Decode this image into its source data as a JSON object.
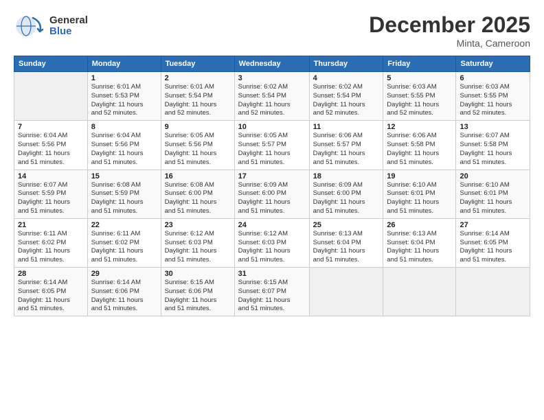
{
  "logo": {
    "general": "General",
    "blue": "Blue"
  },
  "header": {
    "title": "December 2025",
    "location": "Minta, Cameroon"
  },
  "days_of_week": [
    "Sunday",
    "Monday",
    "Tuesday",
    "Wednesday",
    "Thursday",
    "Friday",
    "Saturday"
  ],
  "weeks": [
    [
      {
        "day": "",
        "info": ""
      },
      {
        "day": "1",
        "info": "Sunrise: 6:01 AM\nSunset: 5:53 PM\nDaylight: 11 hours\nand 52 minutes."
      },
      {
        "day": "2",
        "info": "Sunrise: 6:01 AM\nSunset: 5:54 PM\nDaylight: 11 hours\nand 52 minutes."
      },
      {
        "day": "3",
        "info": "Sunrise: 6:02 AM\nSunset: 5:54 PM\nDaylight: 11 hours\nand 52 minutes."
      },
      {
        "day": "4",
        "info": "Sunrise: 6:02 AM\nSunset: 5:54 PM\nDaylight: 11 hours\nand 52 minutes."
      },
      {
        "day": "5",
        "info": "Sunrise: 6:03 AM\nSunset: 5:55 PM\nDaylight: 11 hours\nand 52 minutes."
      },
      {
        "day": "6",
        "info": "Sunrise: 6:03 AM\nSunset: 5:55 PM\nDaylight: 11 hours\nand 52 minutes."
      }
    ],
    [
      {
        "day": "7",
        "info": "Sunrise: 6:04 AM\nSunset: 5:56 PM\nDaylight: 11 hours\nand 51 minutes."
      },
      {
        "day": "8",
        "info": "Sunrise: 6:04 AM\nSunset: 5:56 PM\nDaylight: 11 hours\nand 51 minutes."
      },
      {
        "day": "9",
        "info": "Sunrise: 6:05 AM\nSunset: 5:56 PM\nDaylight: 11 hours\nand 51 minutes."
      },
      {
        "day": "10",
        "info": "Sunrise: 6:05 AM\nSunset: 5:57 PM\nDaylight: 11 hours\nand 51 minutes."
      },
      {
        "day": "11",
        "info": "Sunrise: 6:06 AM\nSunset: 5:57 PM\nDaylight: 11 hours\nand 51 minutes."
      },
      {
        "day": "12",
        "info": "Sunrise: 6:06 AM\nSunset: 5:58 PM\nDaylight: 11 hours\nand 51 minutes."
      },
      {
        "day": "13",
        "info": "Sunrise: 6:07 AM\nSunset: 5:58 PM\nDaylight: 11 hours\nand 51 minutes."
      }
    ],
    [
      {
        "day": "14",
        "info": "Sunrise: 6:07 AM\nSunset: 5:59 PM\nDaylight: 11 hours\nand 51 minutes."
      },
      {
        "day": "15",
        "info": "Sunrise: 6:08 AM\nSunset: 5:59 PM\nDaylight: 11 hours\nand 51 minutes."
      },
      {
        "day": "16",
        "info": "Sunrise: 6:08 AM\nSunset: 6:00 PM\nDaylight: 11 hours\nand 51 minutes."
      },
      {
        "day": "17",
        "info": "Sunrise: 6:09 AM\nSunset: 6:00 PM\nDaylight: 11 hours\nand 51 minutes."
      },
      {
        "day": "18",
        "info": "Sunrise: 6:09 AM\nSunset: 6:00 PM\nDaylight: 11 hours\nand 51 minutes."
      },
      {
        "day": "19",
        "info": "Sunrise: 6:10 AM\nSunset: 6:01 PM\nDaylight: 11 hours\nand 51 minutes."
      },
      {
        "day": "20",
        "info": "Sunrise: 6:10 AM\nSunset: 6:01 PM\nDaylight: 11 hours\nand 51 minutes."
      }
    ],
    [
      {
        "day": "21",
        "info": "Sunrise: 6:11 AM\nSunset: 6:02 PM\nDaylight: 11 hours\nand 51 minutes."
      },
      {
        "day": "22",
        "info": "Sunrise: 6:11 AM\nSunset: 6:02 PM\nDaylight: 11 hours\nand 51 minutes."
      },
      {
        "day": "23",
        "info": "Sunrise: 6:12 AM\nSunset: 6:03 PM\nDaylight: 11 hours\nand 51 minutes."
      },
      {
        "day": "24",
        "info": "Sunrise: 6:12 AM\nSunset: 6:03 PM\nDaylight: 11 hours\nand 51 minutes."
      },
      {
        "day": "25",
        "info": "Sunrise: 6:13 AM\nSunset: 6:04 PM\nDaylight: 11 hours\nand 51 minutes."
      },
      {
        "day": "26",
        "info": "Sunrise: 6:13 AM\nSunset: 6:04 PM\nDaylight: 11 hours\nand 51 minutes."
      },
      {
        "day": "27",
        "info": "Sunrise: 6:14 AM\nSunset: 6:05 PM\nDaylight: 11 hours\nand 51 minutes."
      }
    ],
    [
      {
        "day": "28",
        "info": "Sunrise: 6:14 AM\nSunset: 6:05 PM\nDaylight: 11 hours\nand 51 minutes."
      },
      {
        "day": "29",
        "info": "Sunrise: 6:14 AM\nSunset: 6:06 PM\nDaylight: 11 hours\nand 51 minutes."
      },
      {
        "day": "30",
        "info": "Sunrise: 6:15 AM\nSunset: 6:06 PM\nDaylight: 11 hours\nand 51 minutes."
      },
      {
        "day": "31",
        "info": "Sunrise: 6:15 AM\nSunset: 6:07 PM\nDaylight: 11 hours\nand 51 minutes."
      },
      {
        "day": "",
        "info": ""
      },
      {
        "day": "",
        "info": ""
      },
      {
        "day": "",
        "info": ""
      }
    ]
  ]
}
